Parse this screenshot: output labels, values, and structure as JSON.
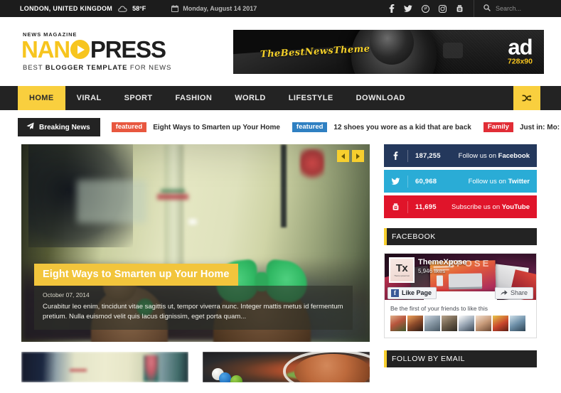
{
  "topbar": {
    "city": "LONDON, UNITED KINGDOM",
    "temperature": "58°F",
    "weather_icon": "cloud-icon",
    "date": "Monday, August 14 2017",
    "calendar_icon": "calendar-icon",
    "social": [
      {
        "name": "facebook-icon",
        "label": "Facebook"
      },
      {
        "name": "twitter-icon",
        "label": "Twitter"
      },
      {
        "name": "pinterest-icon",
        "label": "Pinterest"
      },
      {
        "name": "instagram-icon",
        "label": "Instagram"
      },
      {
        "name": "youtube-icon",
        "label": "YouTube"
      }
    ],
    "search_placeholder": "Search...",
    "search_value": "",
    "bg_color": "#1c1c1c"
  },
  "logo": {
    "kicker": "NEWS MAGAZINE",
    "name_part1": "NAN",
    "name_part2": "PRESS",
    "tagline_1": "BEST ",
    "tagline_2": "BLOGGER TEMPLATE",
    "tagline_3": " FOR NEWS",
    "accent_color": "#f7c51e"
  },
  "ad": {
    "script_text": "TheBestNewsTheme",
    "word": "ad",
    "size": "728x90"
  },
  "nav": {
    "items": [
      {
        "label": "HOME",
        "active": true
      },
      {
        "label": "VIRAL",
        "active": false
      },
      {
        "label": "SPORT",
        "active": false
      },
      {
        "label": "FASHION",
        "active": false
      },
      {
        "label": "WORLD",
        "active": false
      },
      {
        "label": "LIFESTYLE",
        "active": false
      },
      {
        "label": "DOWNLOAD",
        "active": false
      }
    ],
    "shuffle_icon": "shuffle-icon",
    "active_color": "#f9cf3e",
    "bg_color": "#232323"
  },
  "breaking": {
    "label": "Breaking News",
    "label_icon": "paper-plane-icon",
    "items": [
      {
        "tag": "featured",
        "tag_color": "#e8573f",
        "title": "Eight Ways to Smarten up Your Home"
      },
      {
        "tag": "featured",
        "tag_color": "#2f80c2",
        "title": "12 shoes you wore as a kid that are back"
      },
      {
        "tag": "Family",
        "tag_color": "#e12d36",
        "title": "Just in: Mo:"
      }
    ]
  },
  "slider": {
    "prev_icon": "chevron-left-icon",
    "next_icon": "chevron-right-icon",
    "title": "Eight Ways to Smarten up Your Home",
    "date": "October 07, 2014",
    "description": "Curabitur leo enim, tincidunt vitae sagittis ut, tempor viverra nunc. Integer mattis metus id fermentum pretium. Nulla euismod velit quis lacus dignissim, eget porta quam...",
    "title_bg": "#f2c53c"
  },
  "sidebar": {
    "social_counters": [
      {
        "icon": "facebook-icon",
        "count": "187,255",
        "prefix": "Follow us on ",
        "network": "Facebook",
        "color": "#24385c"
      },
      {
        "icon": "twitter-icon",
        "count": "60,968",
        "prefix": "Follow us on ",
        "network": "Twitter",
        "color": "#2aacd6"
      },
      {
        "icon": "youtube-icon",
        "count": "11,695",
        "prefix": "Subscribe us on ",
        "network": "YouTube",
        "color": "#e0142a"
      }
    ],
    "facebook_widget": {
      "title": "FACEBOOK",
      "cover_word": "XPOSE",
      "avatar_initials": "Tx",
      "avatar_sub": "Theme xposed net",
      "page_name": "ThemeXpose",
      "likes": "5,946 likes",
      "like_button": "Like Page",
      "share_button": "Share",
      "share_icon": "share-arrow-icon",
      "friends_text": "Be the first of your friends to like this",
      "faces_count": 8
    },
    "email_widget": {
      "title": "FOLLOW BY EMAIL"
    }
  }
}
